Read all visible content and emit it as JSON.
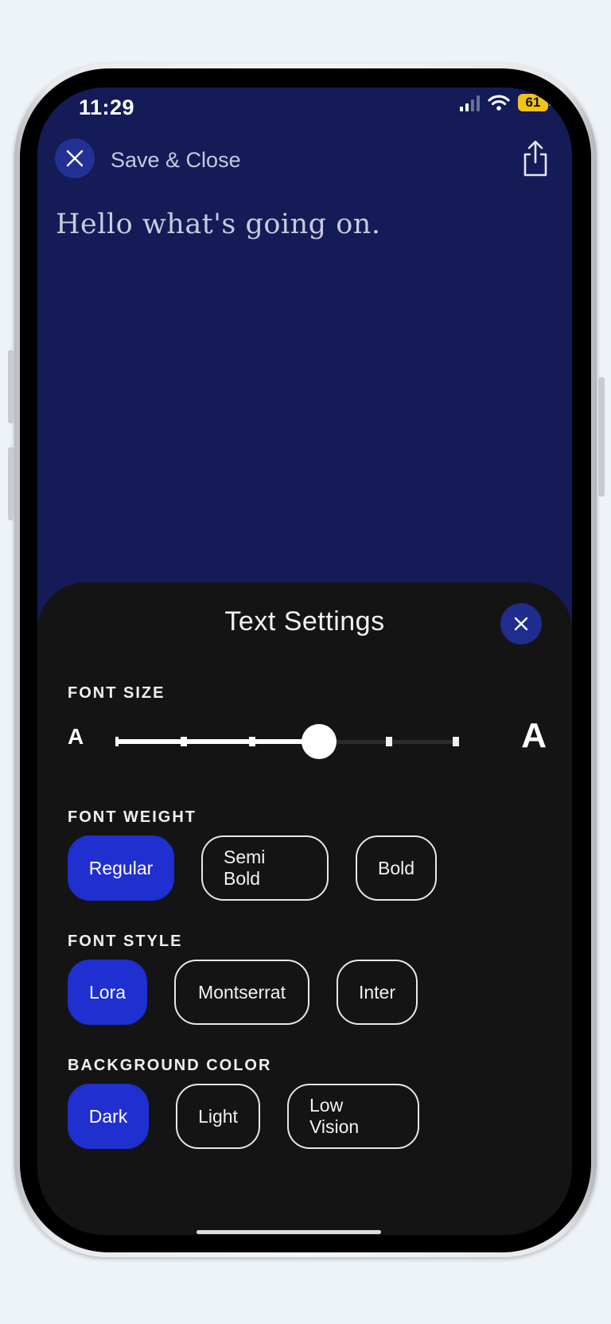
{
  "status_bar": {
    "time": "11:29",
    "battery": "61"
  },
  "header": {
    "save_close_label": "Save & Close"
  },
  "document": {
    "text": "Hello what's going on."
  },
  "text_settings": {
    "title": "Text Settings",
    "font_size": {
      "label": "FONT SIZE",
      "small_glyph": "A",
      "large_glyph": "A",
      "steps": 6,
      "selected_step": 4
    },
    "font_weight": {
      "label": "FONT WEIGHT",
      "options": [
        "Regular",
        "Semi Bold",
        "Bold"
      ],
      "selected": "Regular"
    },
    "font_style": {
      "label": "FONT STYLE",
      "options": [
        "Lora",
        "Montserrat",
        "Inter"
      ],
      "selected": "Lora"
    },
    "background_color": {
      "label": "BACKGROUND COLOR",
      "options": [
        "Dark",
        "Light",
        "Low Vision"
      ],
      "selected": "Dark"
    }
  },
  "colors": {
    "reading_background": "#141b57",
    "sheet_background": "#141414",
    "accent": "#1f2fd0"
  },
  "icons": [
    "close-icon",
    "share-icon",
    "signal-icon",
    "wifi-icon",
    "battery-icon"
  ]
}
